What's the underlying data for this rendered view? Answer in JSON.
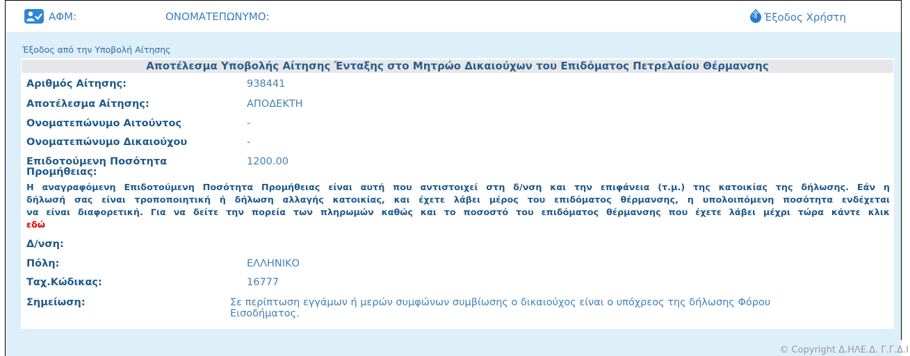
{
  "header": {
    "user_icon": "user-check-icon",
    "afm_label": "ΑΦΜ:",
    "fullname_label": "ΟΝΟΜΑΤΕΠΩΝΥΜΟ:",
    "logout_icon": "logout-arrow-icon",
    "logout_label": "Έξοδος Χρήστη"
  },
  "exit_application_link": "Έξοδος από την Υποβολή Αίτησης",
  "result": {
    "title": "Αποτέλεσμα Υποβολής Αίτησης Ένταξης στο Μητρώο Δικαιούχων του Επιδόματος Πετρελαίου Θέρμανσης",
    "application_number": {
      "label": "Αριθμός Αίτησης:",
      "value": "938441"
    },
    "application_result": {
      "label": "Αποτέλεσμα Αίτησης:",
      "value": "ΑΠΟΔΕΚΤΗ"
    },
    "applicant_name": {
      "label": "Ονοματεπώνυμο Αιτούντος",
      "value": "-"
    },
    "beneficiary_name": {
      "label": "Ονοματεπώνυμο Δικαιούχου",
      "value": "-"
    },
    "subsidized_quantity": {
      "label": "Επιδοτούμενη Ποσότητα Προμήθειας:",
      "value": "1200.00"
    },
    "notice": {
      "lines": [
        "Η αναγραφόμενη Επιδοτούμενη Ποσότητα Προμήθειας είναι αυτή που αντιστοιχεί στη δ/νση και την επιφάνεια (τ.μ.) της κατοικίας της δήλωσης. Εάν η",
        "δήλωσή σας είναι τροποποιητική ή δήλωση αλλαγής κατοικίας, και έχετε λάβει μέρος του επιδόματος θέρμανσης, η υπολοιπόμενη ποσότητα ενδέχεται",
        "να είναι διαφορετική. Για να δείτε την πορεία των πληρωμών καθώς και το ποσοστό του επιδόματος θέρμανσης που έχετε λάβει μέχρι τώρα κάντε κλικ"
      ],
      "link_text": "εδώ"
    },
    "address": {
      "label": "Δ/νση:"
    },
    "city": {
      "label": "Πόλη:",
      "value": "ΕΛΛΗΝΙΚΟ"
    },
    "postal_code": {
      "label": "Ταχ.Κώδικας:",
      "value": "16777"
    },
    "note": {
      "label": "Σημείωση:",
      "value": "Σε περίπτωση εγγάμων ή μερών συμφώνων συμβίωσης ο δικαιούχος είναι ο υπόχρεος της δήλωσης Φόρου Εισοδήματος."
    }
  },
  "footer": {
    "copyright": "© Copyright Δ.ΗΛΕ.Δ. Γ.Γ.Δ.Ι"
  },
  "colors": {
    "page_background": "#ddeff8",
    "header_text": "#3a7dbd",
    "label_text": "#1f5a8c",
    "value_text": "#4280b6",
    "title_bar": "#e7e7eb",
    "link_red": "#e60000"
  }
}
